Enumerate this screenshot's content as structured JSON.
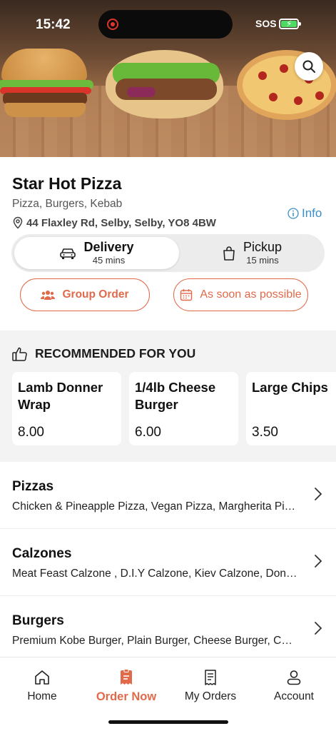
{
  "status_bar": {
    "time": "15:42",
    "sos": "SOS"
  },
  "colors": {
    "accent": "#e06a4a",
    "info": "#3a8fc6",
    "section_bg": "#f3f3f3"
  },
  "restaurant": {
    "name": "Star Hot Pizza",
    "cuisine": "Pizza, Burgers, Kebab",
    "address": "44 Flaxley Rd, Selby, Selby, YO8 4BW",
    "info_label": "Info"
  },
  "order_mode": {
    "selected": "Delivery",
    "options": [
      {
        "label": "Delivery",
        "time": "45 mins",
        "icon": "car-icon"
      },
      {
        "label": "Pickup",
        "time": "15 mins",
        "icon": "bag-icon"
      }
    ]
  },
  "actions": {
    "group_order": "Group Order",
    "schedule": "As soon as possible"
  },
  "recommended": {
    "heading": "RECOMMENDED FOR YOU",
    "items": [
      {
        "name": "Lamb Donner Wrap",
        "price": "8.00"
      },
      {
        "name": "1/4lb Cheese Burger",
        "price": "6.00"
      },
      {
        "name": "Large Chips",
        "price": "3.50"
      }
    ]
  },
  "categories": [
    {
      "title": "Pizzas",
      "desc": "Chicken & Pineapple Pizza, Vegan Pizza, Margherita Pi…"
    },
    {
      "title": "Calzones",
      "desc": "Meat Feast Calzone , D.I.Y Calzone, Kiev Calzone, Don…"
    },
    {
      "title": "Burgers",
      "desc": "Premium Kobe Burger, Plain Burger, Cheese Burger, C…"
    }
  ],
  "nav": {
    "items": [
      {
        "label": "Home",
        "icon": "home-icon"
      },
      {
        "label": "Order Now",
        "icon": "order-icon"
      },
      {
        "label": "My Orders",
        "icon": "receipt-icon"
      },
      {
        "label": "Account",
        "icon": "user-icon"
      }
    ],
    "active": "Order Now"
  }
}
